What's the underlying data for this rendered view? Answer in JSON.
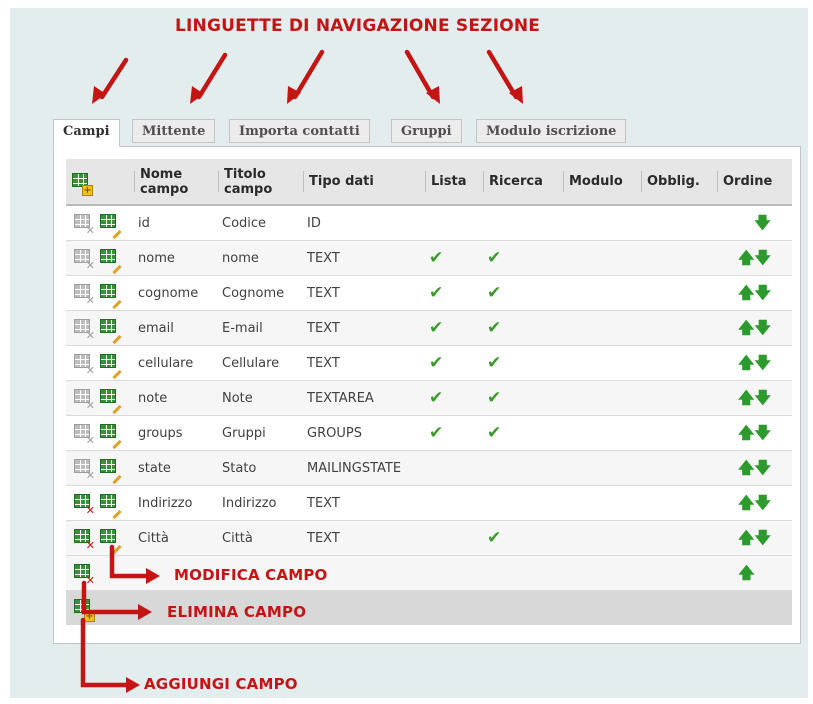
{
  "annotations": {
    "nav_title": "LINGUETTE DI NAVIGAZIONE SEZIONE",
    "edit_field": "MODIFICA CAMPO",
    "delete_field": "ELIMINA CAMPO",
    "add_field": "AGGIUNGI CAMPO"
  },
  "tabs": [
    {
      "label": "Campi",
      "active": true
    },
    {
      "label": "Mittente",
      "active": false
    },
    {
      "label": "Importa contatti",
      "active": false
    },
    {
      "label": "Gruppi",
      "active": false
    },
    {
      "label": "Modulo iscrizione",
      "active": false
    }
  ],
  "table": {
    "headers": {
      "nome_campo_1": "Nome",
      "nome_campo_2": "campo",
      "titolo_campo_1": "Titolo",
      "titolo_campo_2": "campo",
      "tipo_dati": "Tipo dati",
      "lista": "Lista",
      "ricerca": "Ricerca",
      "modulo": "Modulo",
      "obblig": "Obblig.",
      "ordine": "Ordine"
    },
    "check_glyph": "✔",
    "arrow_up": "🡅",
    "arrow_down": "🡇",
    "rows": [
      {
        "name": "id",
        "title": "Codice",
        "type": "ID",
        "lista": false,
        "ricerca": false,
        "can_delete": false,
        "up": false,
        "down": true
      },
      {
        "name": "nome",
        "title": "nome",
        "type": "TEXT",
        "lista": true,
        "ricerca": true,
        "can_delete": false,
        "up": true,
        "down": true
      },
      {
        "name": "cognome",
        "title": "Cognome",
        "type": "TEXT",
        "lista": true,
        "ricerca": true,
        "can_delete": false,
        "up": true,
        "down": true
      },
      {
        "name": "email",
        "title": "E-mail",
        "type": "TEXT",
        "lista": true,
        "ricerca": true,
        "can_delete": false,
        "up": true,
        "down": true
      },
      {
        "name": "cellulare",
        "title": "Cellulare",
        "type": "TEXT",
        "lista": true,
        "ricerca": true,
        "can_delete": false,
        "up": true,
        "down": true
      },
      {
        "name": "note",
        "title": "Note",
        "type": "TEXTAREA",
        "lista": true,
        "ricerca": true,
        "can_delete": false,
        "up": true,
        "down": true
      },
      {
        "name": "groups",
        "title": "Gruppi",
        "type": "GROUPS",
        "lista": true,
        "ricerca": true,
        "can_delete": false,
        "up": true,
        "down": true
      },
      {
        "name": "state",
        "title": "Stato",
        "type": "MAILINGSTATE",
        "lista": false,
        "ricerca": false,
        "can_delete": false,
        "up": true,
        "down": true
      },
      {
        "name": "Indirizzo",
        "title": "Indirizzo",
        "type": "TEXT",
        "lista": false,
        "ricerca": false,
        "can_delete": true,
        "up": true,
        "down": true
      },
      {
        "name": "Città",
        "title": "Città",
        "type": "TEXT",
        "lista": false,
        "ricerca": true,
        "can_delete": true,
        "up": true,
        "down": true
      }
    ],
    "extra_row": {
      "can_delete": true,
      "up": true,
      "down": false
    }
  },
  "colors": {
    "annotation_red": "#c41414",
    "check_green": "#3a9a2a",
    "background": "#e3eded"
  },
  "icons": {
    "add": "add-field-icon",
    "edit": "edit-field-icon",
    "delete": "delete-field-icon"
  }
}
